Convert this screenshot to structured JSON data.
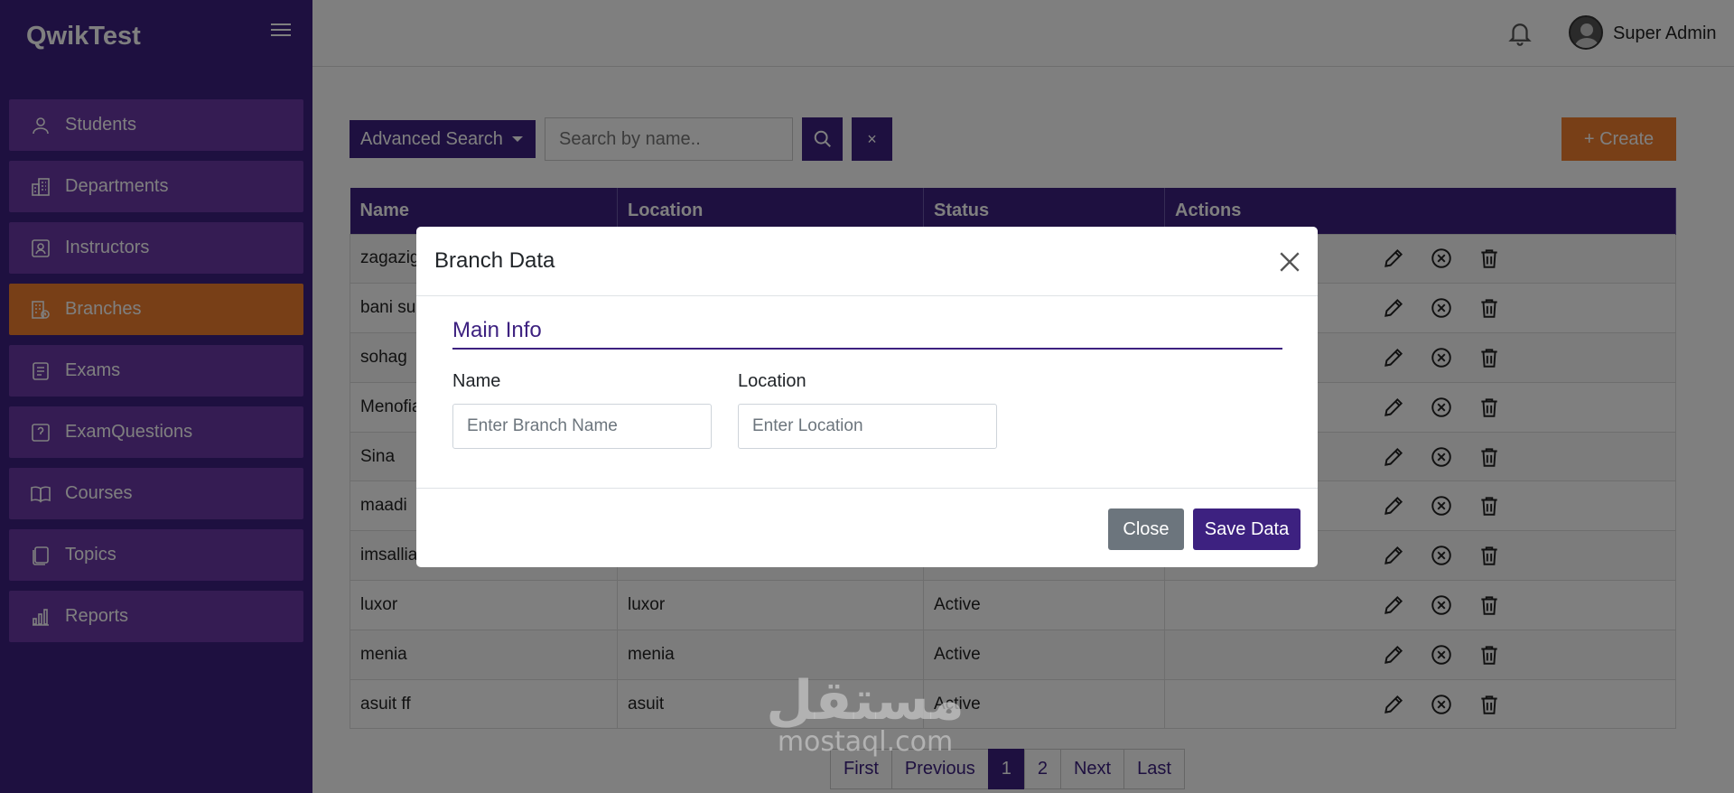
{
  "app": {
    "brand": "QwikTest"
  },
  "header": {
    "username": "Super Admin"
  },
  "sidebar": {
    "items": [
      {
        "label": "Students",
        "icon": "user-icon"
      },
      {
        "label": "Departments",
        "icon": "building-icon"
      },
      {
        "label": "Instructors",
        "icon": "instructor-icon"
      },
      {
        "label": "Branches",
        "icon": "branch-icon",
        "active": true
      },
      {
        "label": "Exams",
        "icon": "exam-icon"
      },
      {
        "label": "ExamQuestions",
        "icon": "question-icon"
      },
      {
        "label": "Courses",
        "icon": "book-icon"
      },
      {
        "label": "Topics",
        "icon": "topics-icon"
      },
      {
        "label": "Reports",
        "icon": "chart-icon"
      }
    ]
  },
  "toolbar": {
    "advanced_search": "Advanced Search",
    "search_placeholder": "Search by name..",
    "clear_label": "×",
    "create_label": "+ Create"
  },
  "table": {
    "headers": [
      "Name",
      "Location",
      "Status",
      "Actions"
    ],
    "rows": [
      {
        "name": "zagazig",
        "location": "",
        "status": ""
      },
      {
        "name": "bani suef",
        "location": "",
        "status": ""
      },
      {
        "name": "sohag",
        "location": "",
        "status": ""
      },
      {
        "name": "Menofia",
        "location": "",
        "status": ""
      },
      {
        "name": "Sina",
        "location": "",
        "status": ""
      },
      {
        "name": "maadi",
        "location": "",
        "status": ""
      },
      {
        "name": "imsallia",
        "location": "",
        "status": ""
      },
      {
        "name": "luxor",
        "location": "luxor",
        "status": "Active"
      },
      {
        "name": "menia",
        "location": "menia",
        "status": "Active"
      },
      {
        "name": "asuit ff",
        "location": "asuit",
        "status": "Active"
      }
    ]
  },
  "pagination": {
    "first": "First",
    "previous": "Previous",
    "pages": [
      "1",
      "2"
    ],
    "active_page": "1",
    "next": "Next",
    "last": "Last"
  },
  "modal": {
    "title": "Branch Data",
    "section": "Main Info",
    "name_label": "Name",
    "name_placeholder": "Enter Branch Name",
    "location_label": "Location",
    "location_placeholder": "Enter Location",
    "close_label": "Close",
    "save_label": "Save Data"
  },
  "watermark": {
    "arabic": "مستقل",
    "latin": "mostaql.com"
  },
  "colors": {
    "primary": "#3d2180",
    "nav_item": "#6a38a6",
    "accent": "#f17f2e",
    "secondary": "#6c757d"
  }
}
